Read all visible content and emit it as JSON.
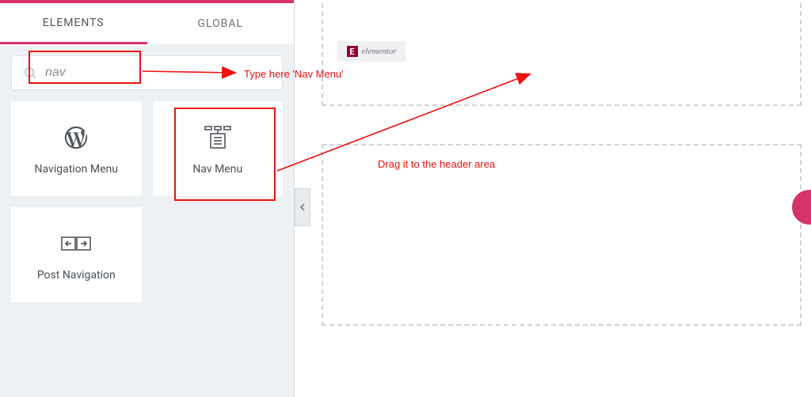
{
  "panel": {
    "tabs": {
      "elements": "ELEMENTS",
      "global": "GLOBAL"
    },
    "search": {
      "value": "nav"
    },
    "widgets": {
      "navigation_menu": "Navigation Menu",
      "nav_menu": "Nav Menu",
      "post_navigation": "Post Navigation"
    }
  },
  "canvas": {
    "logo_text": "elementor"
  },
  "annotations": {
    "type_hint": "Type here 'Nav Menu'",
    "drag_hint": "Drag it to the header area"
  }
}
